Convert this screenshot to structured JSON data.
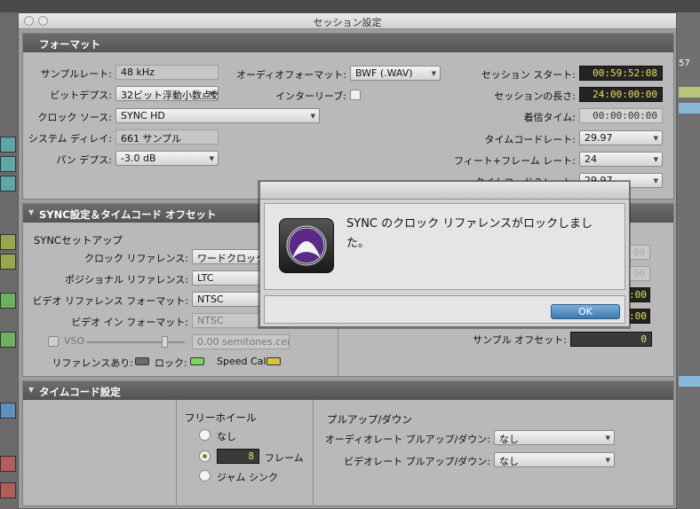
{
  "window": {
    "title": "セッション設定"
  },
  "bg": {
    "right_counter": "57"
  },
  "format": {
    "header": "フォーマット",
    "sample_rate_label": "サンプルレート:",
    "sample_rate": "48 kHz",
    "bit_depth_label": "ビットデプス:",
    "bit_depth": "32ビット浮動小数点数",
    "clock_source_label": "クロック ソース:",
    "clock_source": "SYNC HD",
    "system_delay_label": "システム ディレイ:",
    "system_delay": "661 サンプル",
    "pan_depth_label": "パン デプス:",
    "pan_depth": "-3.0 dB",
    "audio_format_label": "オーディオフォーマット:",
    "audio_format": "BWF (.WAV)",
    "interleave_label": "インターリーブ:",
    "session_start_label": "セッション スタート:",
    "session_start": "00:59:52:08",
    "session_length_label": "セッションの長さ:",
    "session_length": "24:00:00:00",
    "incoming_time_label": "着信タイム:",
    "incoming_time": "00:00:00:00",
    "timecode_rate_label": "タイムコードレート:",
    "timecode_rate": "29.97",
    "feet_frames_label": "フィート+フレーム レート:",
    "feet_frames": "24",
    "timecode2_label": "タイムコード２レート:",
    "timecode2": "29.97"
  },
  "sync": {
    "header": "SYNC設定＆タイムコード オフセット",
    "setup_title": "SYNCセットアップ",
    "clock_ref_label": "クロック リファレンス:",
    "clock_ref": "ワードクロック",
    "position_ref_label": "ポジショナル リファレンス:",
    "position_ref": "LTC",
    "video_ref_label": "ビデオ リファレンス フォーマット:",
    "video_ref": "NTSC",
    "video_in_label": "ビデオ イン フォーマット:",
    "video_in": "NTSC",
    "vso_label": "VSO",
    "vso_value": "0.00  semitones.cents",
    "ref_present_label": "リファレンスあり:",
    "lock_label": "ロック:",
    "speed_cal_label": "Speed Cal:",
    "offset_a": "00",
    "offset_b": "00",
    "offset_c": ":00",
    "offset_d": ":00",
    "sample_offset_label": "サンプル オフセット:",
    "sample_offset": "0",
    "colors": {
      "ref_led": "#6b6b6b",
      "lock_led": "#7bd65b",
      "speed_led": "#d8c53a"
    }
  },
  "timecode": {
    "header": "タイムコード設定",
    "freewheel_title": "フリーホイール",
    "opt_none": "なし",
    "frames_value": "8",
    "frames_label": "フレーム",
    "jam_sync": "ジャム シンク",
    "pullup_title": "プルアップ/ダウン",
    "audio_pull_label": "オーディオレート プルアップ/ダウン:",
    "audio_pull": "なし",
    "video_pull_label": "ビデオレート プルアップ/ダウン:",
    "video_pull": "なし"
  },
  "alert": {
    "message": "SYNC のクロック リファレンスがロックしました。",
    "ok_label": "OK"
  }
}
